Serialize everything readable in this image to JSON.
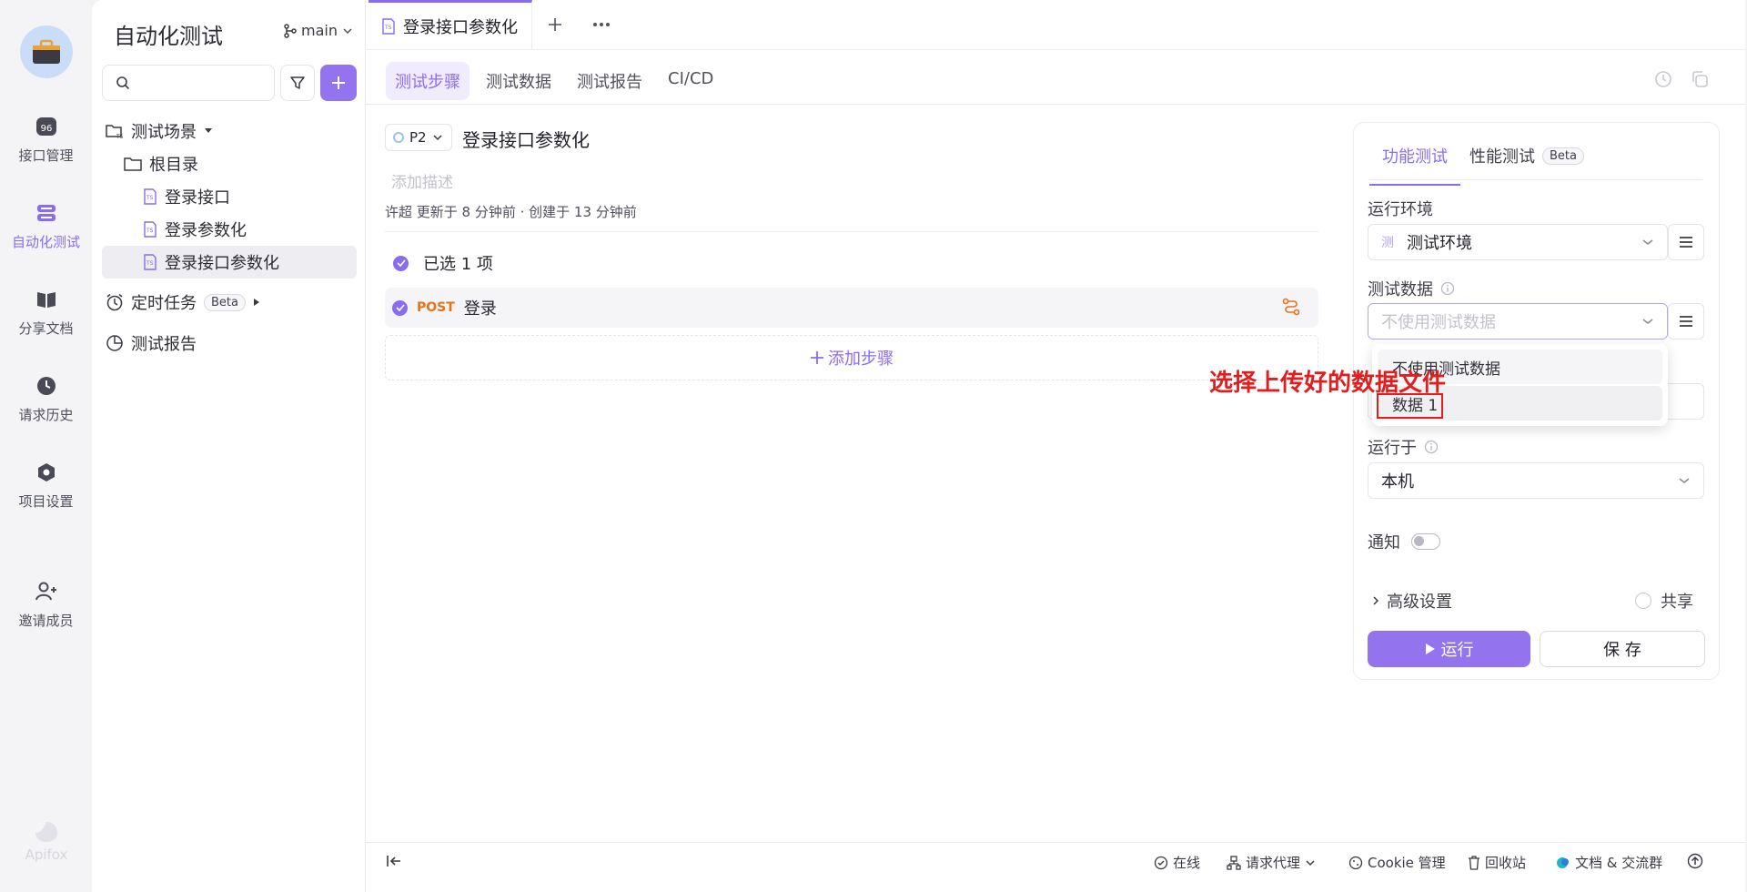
{
  "rail": {
    "items": [
      {
        "label": "接口管理",
        "icon": "api-icon"
      },
      {
        "label": "自动化测试",
        "icon": "automation-icon"
      },
      {
        "label": "分享文档",
        "icon": "book-icon"
      },
      {
        "label": "请求历史",
        "icon": "clock-icon"
      },
      {
        "label": "项目设置",
        "icon": "settings-icon"
      },
      {
        "label": "邀请成员",
        "icon": "add-user-icon"
      }
    ],
    "brand": "Apifox"
  },
  "tree": {
    "title": "自动化测试",
    "branch": "main",
    "scenes_label": "测试场景",
    "root_label": "根目录",
    "cases": [
      "登录接口",
      "登录参数化",
      "登录接口参数化"
    ],
    "scheduled_label": "定时任务",
    "scheduled_badge": "Beta",
    "reports_label": "测试报告"
  },
  "tabs": {
    "current": "登录接口参数化"
  },
  "subtabs": [
    "测试步骤",
    "测试数据",
    "测试报告",
    "CI/CD"
  ],
  "case": {
    "priority": "P2",
    "title": "登录接口参数化",
    "desc_placeholder": "添加描述",
    "meta": "许超 更新于 8 分钟前 · 创建于 13 分钟前",
    "selected_text": "已选 1 项",
    "step_method": "POST",
    "step_name": "登录",
    "add_step": "添加步骤"
  },
  "panel": {
    "tab_functional": "功能测试",
    "tab_performance": "性能测试",
    "tab_perf_badge": "Beta",
    "env_label": "运行环境",
    "env_tag": "测",
    "env_value": "测试环境",
    "data_label": "测试数据",
    "data_placeholder": "不使用测试数据",
    "dropdown_options": [
      "不使用测试数据",
      "数据 1"
    ],
    "run_on_label": "运行于",
    "run_on_value": "本机",
    "notify_label": "通知",
    "notify_on": false,
    "advanced_label": "高级设置",
    "share_label": "共享",
    "run_label": "运行",
    "save_label": "保 存"
  },
  "annotation": {
    "text": "选择上传好的数据文件"
  },
  "footer": {
    "online": "在线",
    "proxy": "请求代理",
    "cookie": "Cookie 管理",
    "recycle": "回收站",
    "docs": "文档 & 交流群"
  },
  "colors": {
    "accent": "#8a6cf0",
    "post": "#e8711a",
    "annotation": "#e01e1e"
  }
}
